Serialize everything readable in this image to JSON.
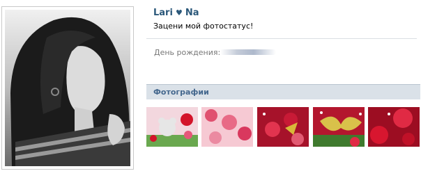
{
  "profile": {
    "name_first": "Lari",
    "name_heart_icon": "heart-icon",
    "name_second": "Na",
    "status": "Зацени мой фотостатус!"
  },
  "info": {
    "birthday_label": "День рождения:"
  },
  "photos_section": {
    "title": "Фотографии",
    "thumbnails": [
      {
        "name": "photo-thumbnail-1",
        "theme": "toy bear with roses"
      },
      {
        "name": "photo-thumbnail-2",
        "theme": "pink roses"
      },
      {
        "name": "photo-thumbnail-3",
        "theme": "red roses with gold butterfly"
      },
      {
        "name": "photo-thumbnail-4",
        "theme": "gold butterfly on roses"
      },
      {
        "name": "photo-thumbnail-5",
        "theme": "red roses"
      }
    ]
  },
  "colors": {
    "name_link": "#2b587a",
    "section_bg": "#dae1e8",
    "section_title": "#45688e",
    "label_gray": "#777777"
  }
}
